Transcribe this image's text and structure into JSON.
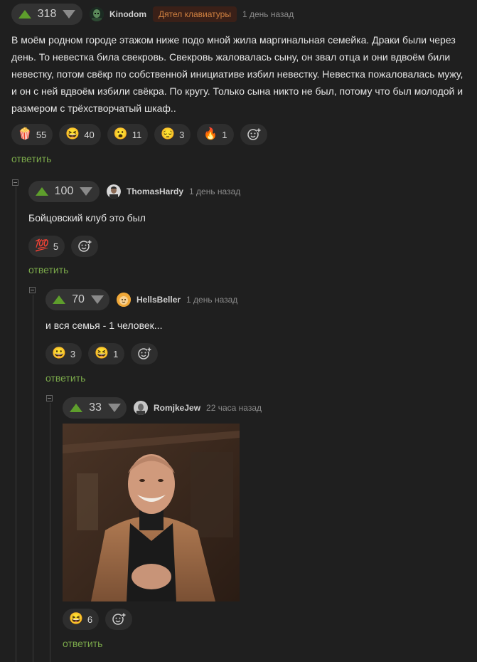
{
  "comments": [
    {
      "score": "318",
      "username": "Kinodom",
      "badge": "Дятел клавиатуры",
      "time": "1 день назад",
      "text": "В моём родном городе этажом ниже подо мной жила маргинальная семейка. Драки были через день. То невестка била свекровь. Свекровь жаловалась сыну, он звал отца и они вдвоём били невестку, потом свёкр по собственной инициативе избил невестку. Невестка пожаловалась мужу, и он с ней вдвоём избили свёкра. По кругу. Только сына никто не был, потому что был молодой и размером с трёхстворчатый шкаф..",
      "reactions": [
        {
          "icon": "popcorn-icon",
          "emoji": "🍿",
          "count": "55"
        },
        {
          "icon": "laughing-face-icon",
          "emoji": "😆",
          "count": "40"
        },
        {
          "icon": "surprised-face-icon",
          "emoji": "😮",
          "count": "11"
        },
        {
          "icon": "sad-face-icon",
          "emoji": "😔",
          "count": "3"
        },
        {
          "icon": "fire-icon",
          "emoji": "🔥",
          "count": "1"
        }
      ],
      "reply": "ответить"
    },
    {
      "score": "100",
      "username": "ThomasHardy",
      "time": "1 день назад",
      "text": "Бойцовский клуб это был",
      "reactions": [
        {
          "icon": "hundred-points-icon",
          "emoji": "💯",
          "count": "5"
        }
      ],
      "reply": "ответить"
    },
    {
      "score": "70",
      "username": "HellsBeller",
      "time": "1 день назад",
      "text": "и вся семья - 1 человек...",
      "reactions": [
        {
          "icon": "grinning-face-icon",
          "emoji": "😀",
          "count": "3"
        },
        {
          "icon": "laughing-face-icon",
          "emoji": "😆",
          "count": "1"
        }
      ],
      "reply": "ответить"
    },
    {
      "score": "33",
      "username": "RomjkeJew",
      "time": "22 часа назад",
      "reactions": [
        {
          "icon": "laughing-face-icon",
          "emoji": "😆",
          "count": "6"
        }
      ],
      "reply": "ответить"
    }
  ],
  "colors": {
    "background": "#1f1f1f",
    "upvote": "#5e9e2c",
    "reply_link": "#7aa84a",
    "badge_text": "#d08040"
  }
}
